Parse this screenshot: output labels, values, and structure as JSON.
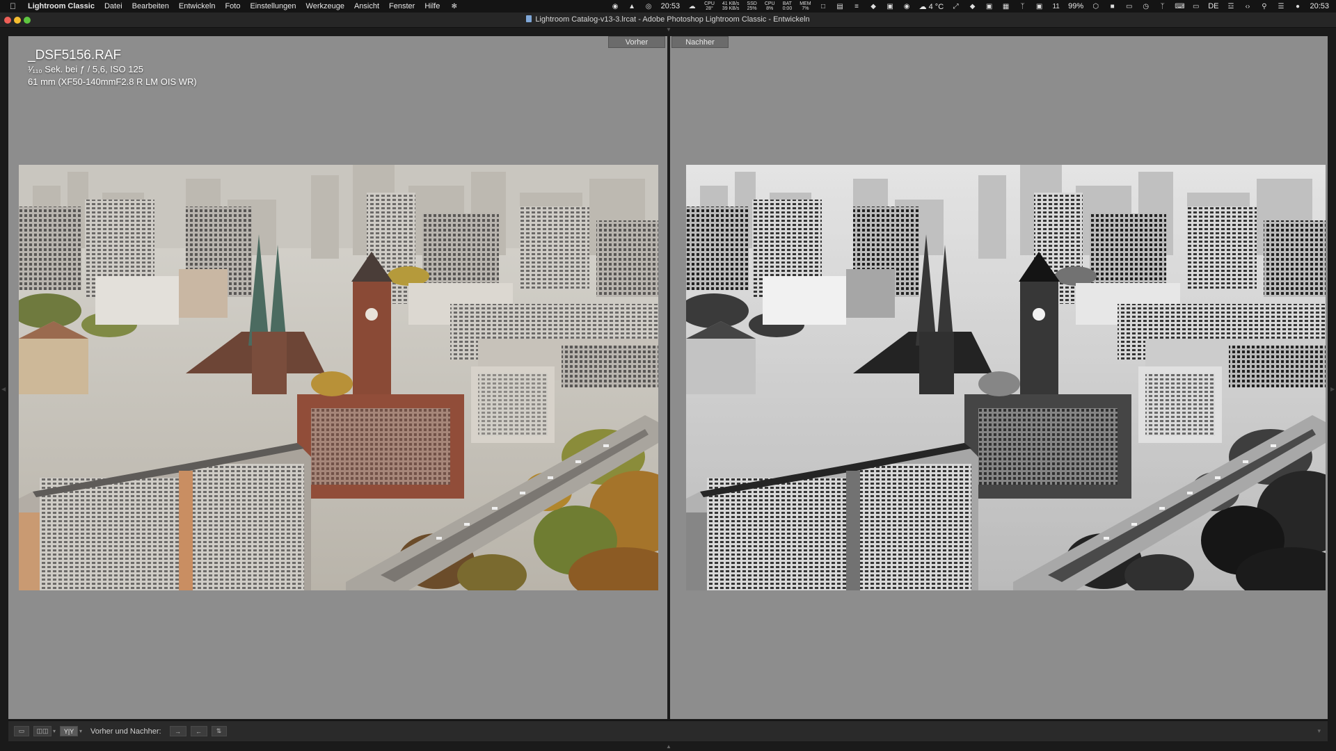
{
  "menubar": {
    "app_name": "Lightroom Classic",
    "items": [
      "Datei",
      "Bearbeiten",
      "Entwickeln",
      "Foto",
      "Einstellungen",
      "Werkzeuge",
      "Ansicht",
      "Fenster",
      "Hilfe"
    ],
    "clock_left": "20:53",
    "cpu_label": "CPU",
    "cpu_temp": "28°",
    "net_up": "41 KB/s",
    "net_down": "39 KB/s",
    "ssd_label": "SSD",
    "ssd_value": "25%",
    "cpu_usage_label": "CPU",
    "cpu_usage_value": "8%",
    "bat_label": "BAT",
    "bat_value": "0:00",
    "mem_label": "MEM",
    "mem_value": "7%",
    "weather": "4 °C",
    "badge_count": "11",
    "battery_percent": "99%",
    "input_source": "DE",
    "clock_right": "20:53"
  },
  "window": {
    "title": "Lightroom Catalog-v13-3.lrcat - Adobe Photoshop Lightroom Classic - Entwickeln"
  },
  "compare": {
    "before_label": "Vorher",
    "after_label": "Nachher"
  },
  "photo_info": {
    "file_name": "_DSF5156.RAF",
    "exposure": "¹⁄₁₁₀ Sek. bei ƒ / 5,6, ISO 125",
    "lens": "61 mm (XF50-140mmF2.8 R LM OIS WR)"
  },
  "toolbar": {
    "before_after_label": "Vorher und Nachher:"
  },
  "colors": {
    "workspace_bg": "#8d8d8d",
    "toolbar_bg": "#2a2a2a",
    "divider": "#1c1c1c",
    "tab_bg": "#6b6b6b"
  }
}
